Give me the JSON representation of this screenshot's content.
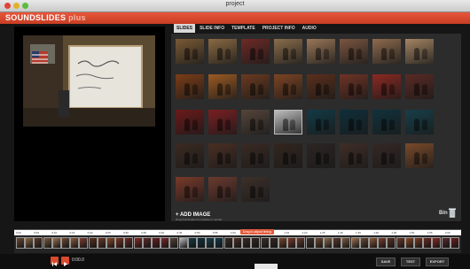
{
  "window": {
    "title": "project"
  },
  "app": {
    "name": "SOUNDSLIDES",
    "edition": "plus"
  },
  "tabs": [
    {
      "label": "SLIDES",
      "active": true
    },
    {
      "label": "SLIDE INFO",
      "active": false
    },
    {
      "label": "TEMPLATE",
      "active": false
    },
    {
      "label": "PROJECT INFO",
      "active": false
    },
    {
      "label": "AUDIO",
      "active": false
    }
  ],
  "library": {
    "add_image_label": "+ ADD IMAGE",
    "add_image_hint": "Drag thumbnails into timeline to reorder",
    "bin_label": "Bin",
    "thumbnails": [
      {
        "scene": "classroom",
        "color": "#7a5a35"
      },
      {
        "scene": "students",
        "color": "#8b6a43"
      },
      {
        "scene": "performers",
        "color": "#6d2a25"
      },
      {
        "scene": "group",
        "color": "#8a6d4c"
      },
      {
        "scene": "group",
        "color": "#9a7758"
      },
      {
        "scene": "closeup",
        "color": "#7a5540"
      },
      {
        "scene": "girl",
        "color": "#8f6b4e"
      },
      {
        "scene": "girls",
        "color": "#a58563"
      },
      {
        "scene": "stage",
        "color": "#7b3d18"
      },
      {
        "scene": "stage",
        "color": "#9b5a22"
      },
      {
        "scene": "stage",
        "color": "#6a3a20"
      },
      {
        "scene": "stage",
        "color": "#7c4422"
      },
      {
        "scene": "stage",
        "color": "#5b2f1b"
      },
      {
        "scene": "dancer",
        "color": "#6f3325"
      },
      {
        "scene": "red-dress",
        "color": "#8b2a22"
      },
      {
        "scene": "singer",
        "color": "#5a2a24"
      },
      {
        "scene": "red-stage",
        "color": "#6b1a1a"
      },
      {
        "scene": "red-stage",
        "color": "#7a1f22"
      },
      {
        "scene": "portrait",
        "color": "#55453a"
      },
      {
        "scene": "piano",
        "color": "#bdbdbd"
      },
      {
        "scene": "dark-stage",
        "color": "#123a46"
      },
      {
        "scene": "dark-stage",
        "color": "#0f2f3a"
      },
      {
        "scene": "dark-stage",
        "color": "#10323c"
      },
      {
        "scene": "dark-stage",
        "color": "#173f4a"
      },
      {
        "scene": "dancers",
        "color": "#3b2a22"
      },
      {
        "scene": "couple",
        "color": "#4a2f23"
      },
      {
        "scene": "dancers",
        "color": "#3a2a24"
      },
      {
        "scene": "dancers",
        "color": "#33261f"
      },
      {
        "scene": "backstage",
        "color": "#2c2523"
      },
      {
        "scene": "figure",
        "color": "#3f2e27"
      },
      {
        "scene": "figure",
        "color": "#352824"
      },
      {
        "scene": "crowd",
        "color": "#7a4a2a"
      },
      {
        "scene": "hug",
        "color": "#7a3a2a"
      },
      {
        "scene": "hug",
        "color": "#6b3a2e"
      },
      {
        "scene": "group",
        "color": "#3d3029"
      }
    ]
  },
  "timeline": {
    "drag_tip": "Drag to adjust timing",
    "ticks": [
      "0:00",
      "0:05",
      "0:10",
      "0:15",
      "0:20",
      "0:25",
      "0:30",
      "0:35",
      "0:40",
      "0:45",
      "0:50",
      "0:55",
      "1:00",
      "1:05",
      "1:10",
      "1:15",
      "1:20",
      "1:25",
      "1:30",
      "1:35",
      "1:40",
      "1:45",
      "1:50",
      "1:55",
      "2:00"
    ],
    "frames": [
      "#6d4a30",
      "#8a6a48",
      "#5a3a2a",
      "#7a5a40",
      "#9a7050",
      "#6b4a35",
      "#8b5a3a",
      "#7a4030",
      "#5b3020",
      "#6a3a28",
      "#8b4a28",
      "#7a3a22",
      "#6a2a22",
      "#8a2a22",
      "#5a2a2a",
      "#6a2020",
      "#7a2a2a",
      "#55453a",
      "#bdbdbd",
      "#153a44",
      "#123040",
      "#173f4a",
      "#123a46",
      "#3b2a22",
      "#4a2f23",
      "#3a2a24",
      "#33261f",
      "#3f2e27",
      "#352824",
      "#7a4a2a",
      "#7a3a2a",
      "#6b3a2e",
      "#3d3029",
      "#6d4a30",
      "#8a6a48",
      "#5a3a2a",
      "#7a5a40",
      "#9a7050",
      "#6b4a35",
      "#8b5a3a",
      "#7a4030",
      "#5b3020",
      "#6a3a28",
      "#8b4a28",
      "#7a3a22",
      "#6a2a22",
      "#8a2a22",
      "#5a2a2a",
      "#6a2020"
    ]
  },
  "transport": {
    "time": "0:00.0"
  },
  "actions": {
    "save": "SAVE",
    "test": "TEST",
    "export": "EXPORT"
  },
  "colors": {
    "accent": "#d94a2e",
    "panel": "#2c2c2c",
    "background": "#161616"
  }
}
